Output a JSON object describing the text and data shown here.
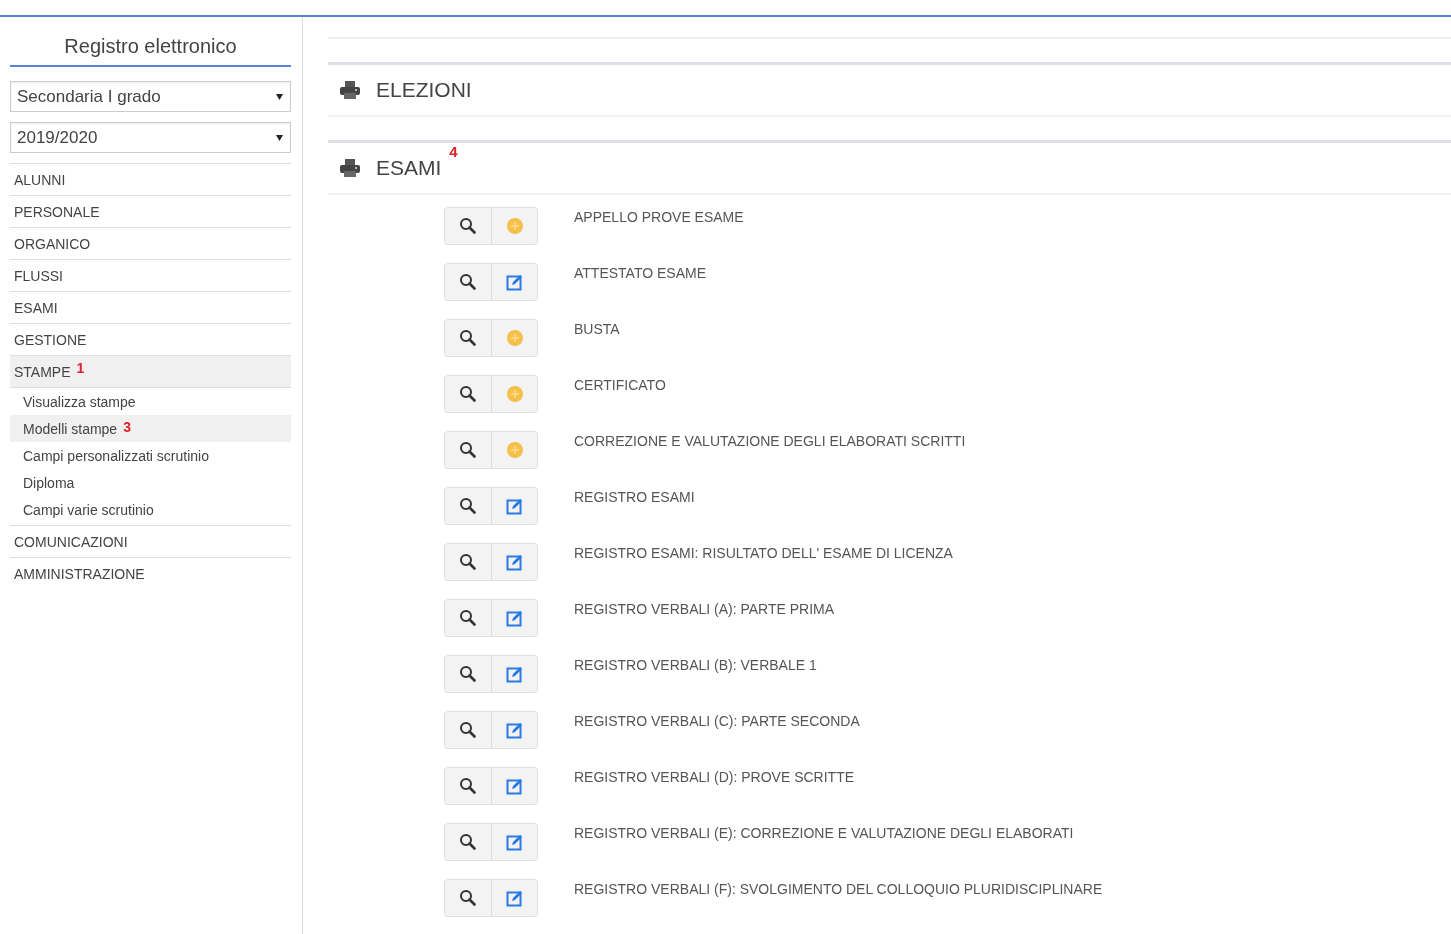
{
  "sidebar": {
    "title": "Registro elettronico",
    "selects": [
      {
        "value": "Secondaria I grado"
      },
      {
        "value": "2019/2020"
      }
    ],
    "menu": [
      {
        "label": "ALUNNI",
        "selected": false
      },
      {
        "label": "PERSONALE",
        "selected": false
      },
      {
        "label": "ORGANICO",
        "selected": false
      },
      {
        "label": "FLUSSI",
        "selected": false
      },
      {
        "label": "ESAMI",
        "selected": false
      },
      {
        "label": "GESTIONE",
        "selected": false
      },
      {
        "label": "STAMPE",
        "selected": true,
        "marker": "1",
        "children": [
          {
            "label": "Visualizza stampe",
            "selected": false
          },
          {
            "label": "Modelli stampe",
            "selected": true,
            "marker": "3"
          },
          {
            "label": "Campi personalizzati scrutinio",
            "selected": false
          },
          {
            "label": "Diploma",
            "selected": false
          },
          {
            "label": "Campi varie scrutinio",
            "selected": false
          }
        ]
      },
      {
        "label": "COMUNICAZIONI",
        "selected": false
      },
      {
        "label": "AMMINISTRAZIONE",
        "selected": false
      }
    ]
  },
  "sections": [
    {
      "title": "ELEZIONI"
    },
    {
      "title": "ESAMI",
      "marker": "4",
      "items": [
        {
          "label": "APPELLO PROVE ESAME",
          "kind": "add"
        },
        {
          "label": "ATTESTATO ESAME",
          "kind": "edit"
        },
        {
          "label": "BUSTA",
          "kind": "add"
        },
        {
          "label": "CERTIFICATO",
          "kind": "add"
        },
        {
          "label": "CORREZIONE E VALUTAZIONE DEGLI ELABORATI SCRITTI",
          "kind": "add"
        },
        {
          "label": "REGISTRO ESAMI",
          "kind": "edit"
        },
        {
          "label": "REGISTRO ESAMI: RISULTATO DELL' ESAME DI LICENZA",
          "kind": "edit"
        },
        {
          "label": "REGISTRO VERBALI (A): PARTE PRIMA",
          "kind": "edit"
        },
        {
          "label": "REGISTRO VERBALI (B): VERBALE 1",
          "kind": "edit"
        },
        {
          "label": "REGISTRO VERBALI (C): PARTE SECONDA",
          "kind": "edit"
        },
        {
          "label": "REGISTRO VERBALI (D): PROVE SCRITTE",
          "kind": "edit"
        },
        {
          "label": "REGISTRO VERBALI (E): CORREZIONE E VALUTAZIONE DEGLI ELABORATI",
          "kind": "edit"
        },
        {
          "label": "REGISTRO VERBALI (F): SVOLGIMENTO DEL COLLOQUIO PLURIDISCIPLINARE",
          "kind": "edit"
        }
      ]
    }
  ]
}
